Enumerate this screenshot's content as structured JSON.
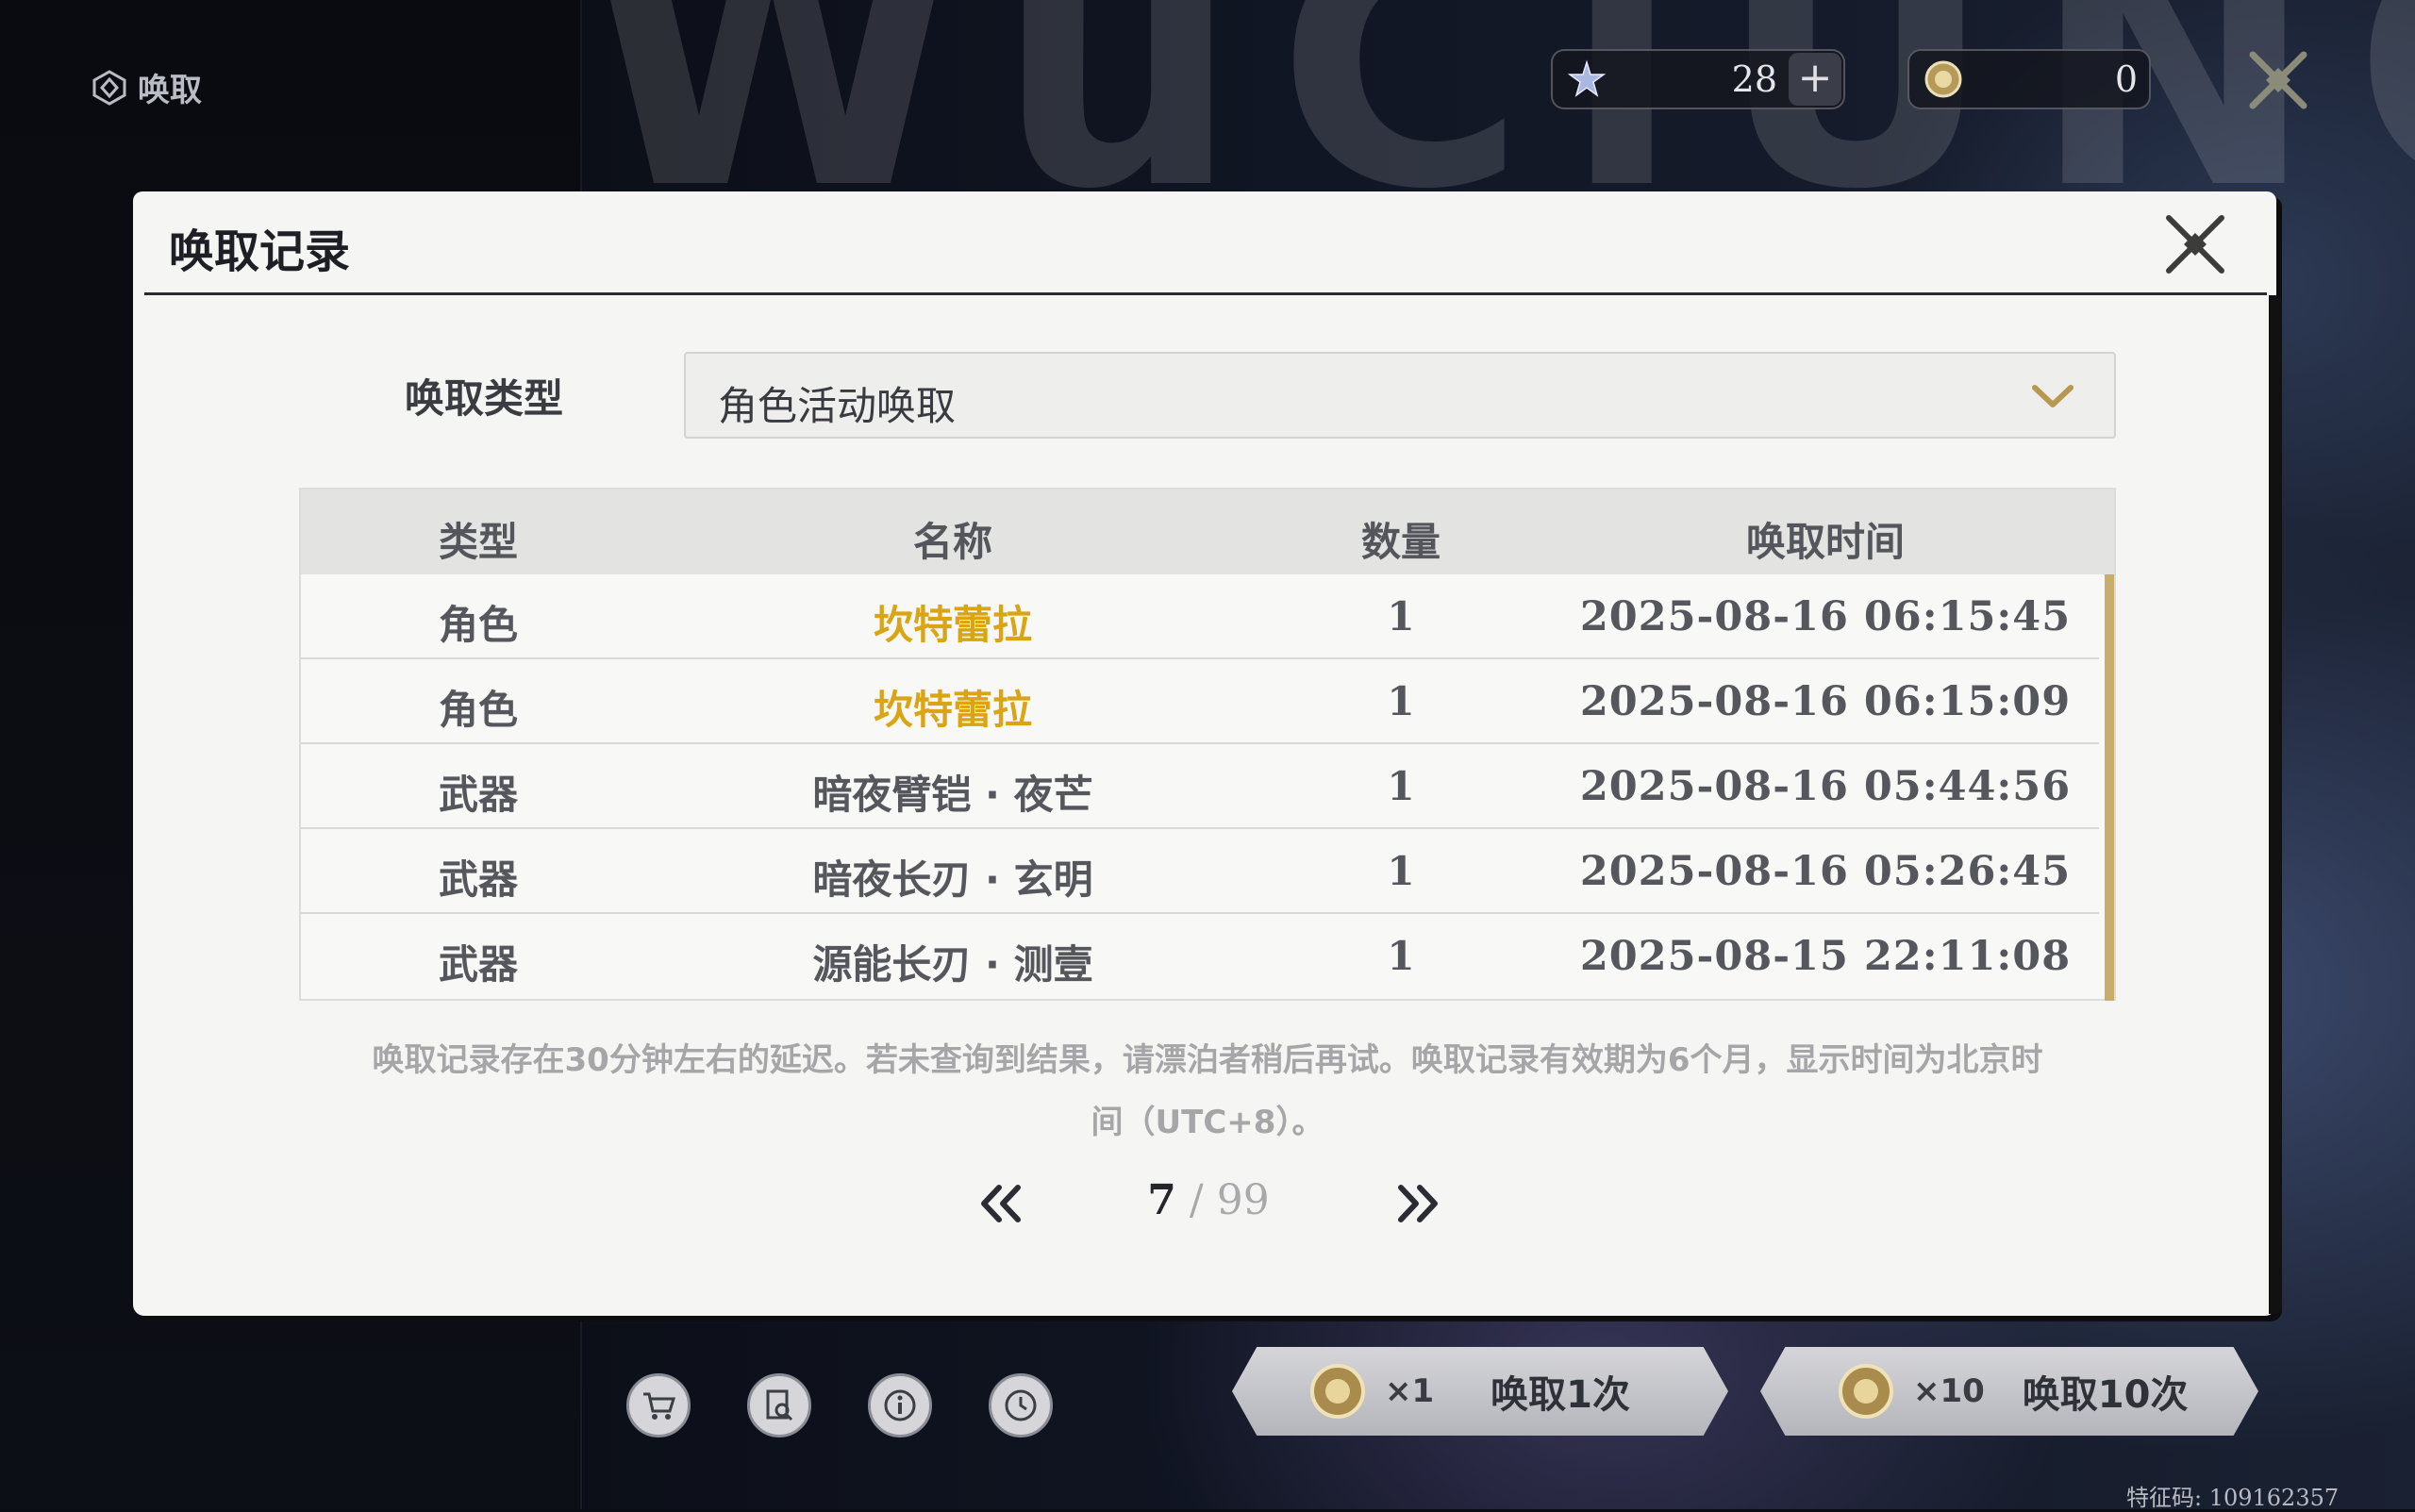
{
  "page": {
    "title": "唤取",
    "currency_star": "28",
    "currency_coin": "0",
    "feature_code": "特征码: 109162357"
  },
  "modal": {
    "title": "唤取记录",
    "type_label": "唤取类型",
    "type_selected": "角色活动唤取",
    "columns": [
      "类型",
      "名称",
      "数量",
      "唤取时间"
    ],
    "rows": [
      {
        "type": "角色",
        "name": "坎特蕾拉",
        "qty": "1",
        "time": "2025-08-16 06:15:45"
      },
      {
        "type": "角色",
        "name": "坎特蕾拉",
        "qty": "1",
        "time": "2025-08-16 06:15:09"
      },
      {
        "type": "武器",
        "name": "暗夜臂铠 · 夜芒",
        "qty": "1",
        "time": "2025-08-16 05:44:56"
      },
      {
        "type": "武器",
        "name": "暗夜长刃 · 玄明",
        "qty": "1",
        "time": "2025-08-16 05:26:45"
      },
      {
        "type": "武器",
        "name": "源能长刃 · 测壹",
        "qty": "1",
        "time": "2025-08-15 22:11:08"
      }
    ],
    "notice_line1": "唤取记录存在30分钟左右的延迟。若未查询到结果，请漂泊者稍后再试。唤取记录有效期为6个月，显示时间为北京时",
    "notice_line2": "间（UTC+8）。",
    "pager": {
      "current": "7",
      "sep": " / ",
      "total": "99"
    }
  },
  "bottom": {
    "pull_one_mult": "×1",
    "pull_one_label": "唤取1次",
    "pull_ten_mult": "×10",
    "pull_ten_label": "唤取10次"
  },
  "colors": {
    "accent_gold": "#d9a515",
    "scroll_gold": "#c7ae6a"
  }
}
